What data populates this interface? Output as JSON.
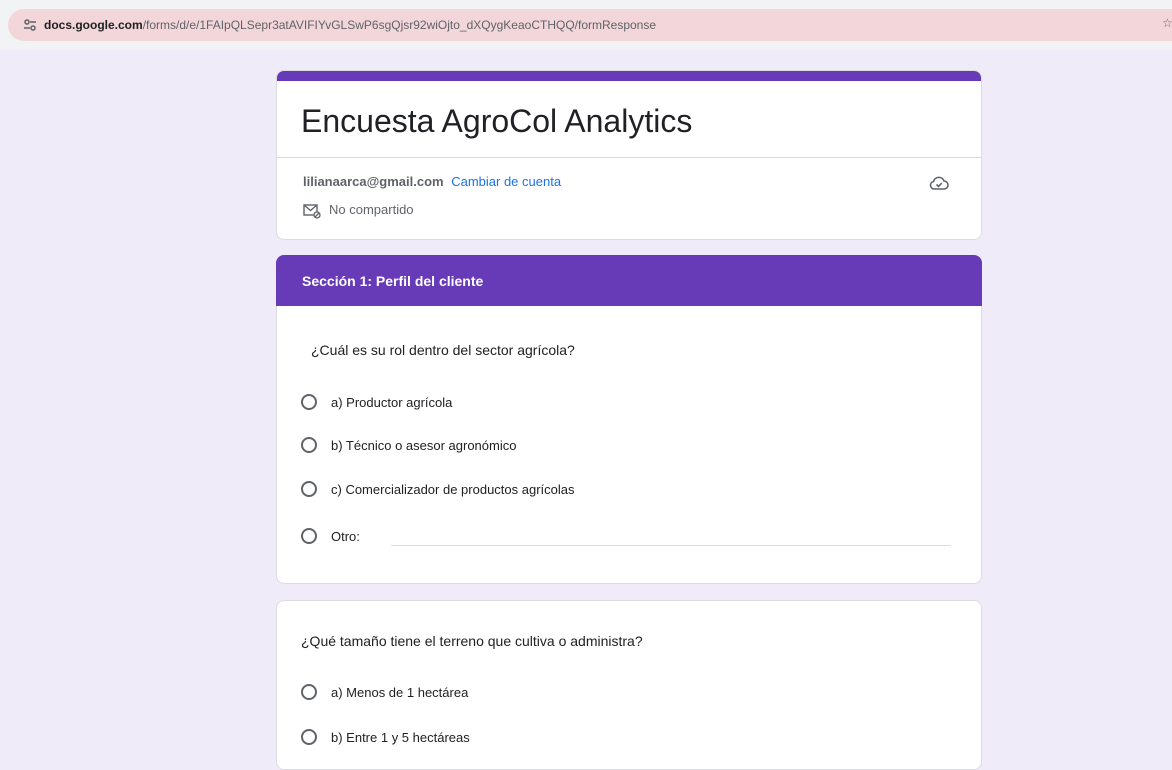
{
  "browser": {
    "url_host": "docs.google.com",
    "url_path": "/forms/d/e/1FAIpQLSepr3atAVIFIYvGLSwP6sgQjsr92wiOjto_dXQygKeaoCTHQQ/formResponse",
    "star_icon": "bookmark-star-icon"
  },
  "form": {
    "title": "Encuesta AgroCol Analytics",
    "account_email": "lilianaarca@gmail.com",
    "switch_account": "Cambiar de cuenta",
    "not_shared": "No compartido",
    "accent_color": "#673ab7"
  },
  "section1": {
    "header": "Sección 1: Perfil del cliente",
    "question1": {
      "text": "¿Cuál es su rol dentro del sector agrícola?",
      "options": [
        "a) Productor agrícola",
        "b) Técnico o asesor agronómico",
        "c) Comercializador de productos agrícolas",
        "Otro:"
      ]
    },
    "question2": {
      "text": "¿Qué tamaño tiene el terreno que cultiva o administra?",
      "options": [
        "a) Menos de 1 hectárea",
        "b) Entre 1 y 5 hectáreas"
      ]
    }
  }
}
